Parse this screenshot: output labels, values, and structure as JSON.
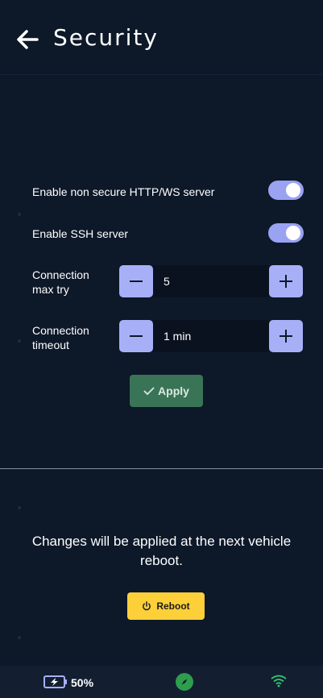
{
  "header": {
    "title": "Security",
    "back_icon": "arrow-left-icon"
  },
  "settings": {
    "http_ws": {
      "label": "Enable non secure HTTP/WS server",
      "enabled": true
    },
    "ssh": {
      "label": "Enable SSH server",
      "enabled": true
    },
    "max_try": {
      "label_line1": "Connection",
      "label_line2": "max try",
      "value": "5"
    },
    "timeout": {
      "label_line1": "Connection",
      "label_line2": "timeout",
      "value": "1 min"
    }
  },
  "apply_button": {
    "label": "Apply",
    "icon": "check-icon"
  },
  "reboot_section": {
    "message": "Changes will be applied at the next vehicle reboot.",
    "button_label": "Reboot",
    "button_icon": "power-icon"
  },
  "status_bar": {
    "battery_percent": "50%",
    "battery_icon": "battery-charging-icon",
    "compass_icon": "compass-icon",
    "wifi_icon": "wifi-icon"
  },
  "colors": {
    "background": "#0d1829",
    "accent": "#a7b0f7",
    "apply": "#3a7456",
    "reboot": "#fdd03a",
    "status_green": "#2e9e4e"
  }
}
